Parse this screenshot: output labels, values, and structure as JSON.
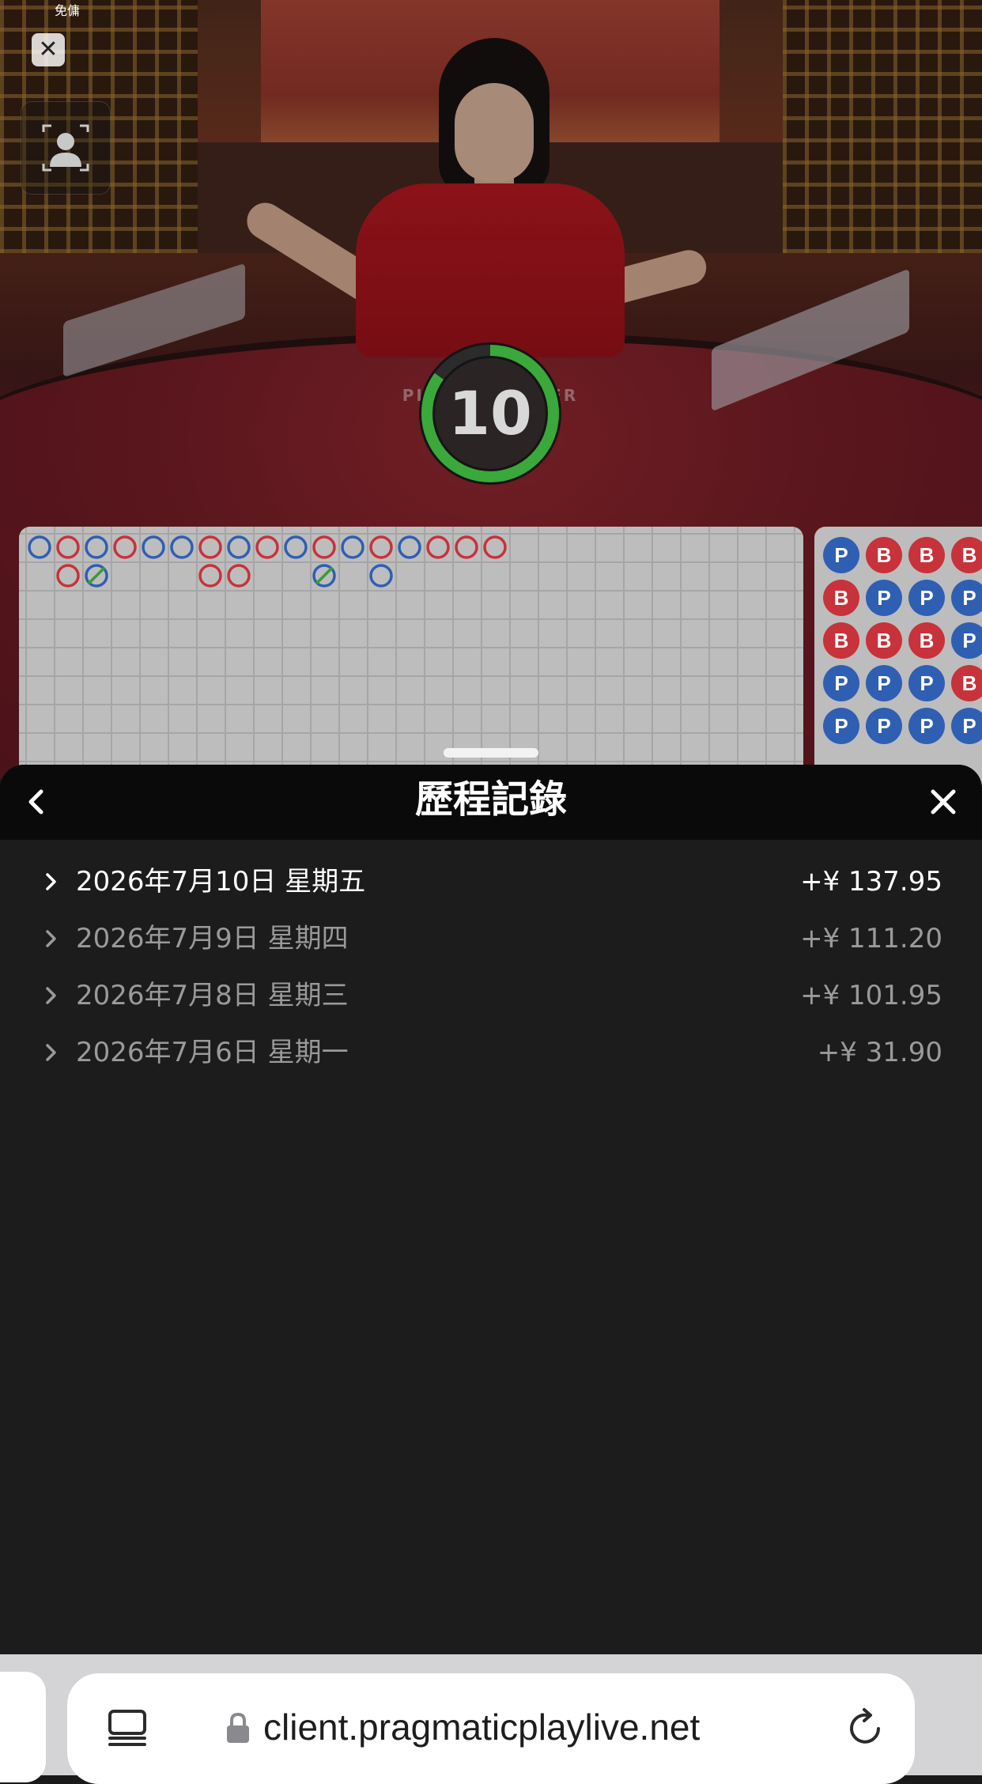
{
  "stream": {
    "mini_label": "免傭",
    "close_icon": "close-icon",
    "camera_icon": "camera-person-icon",
    "table_text": "PLAYER  BANKER",
    "timer": {
      "value": "10",
      "progress": 0.85,
      "ring_color": "#3aa83a"
    }
  },
  "roadmap": {
    "big_road_top": [
      "blue",
      "red",
      "blue",
      "red",
      "blue",
      "blue",
      "red",
      "blue",
      "red",
      "blue",
      "red",
      "blue",
      "red",
      "blue",
      "red",
      "red",
      "red"
    ],
    "big_road_second": [
      null,
      "red",
      "green-slash",
      null,
      null,
      null,
      "red-dot",
      "red",
      null,
      null,
      "green-slash",
      null,
      "blue",
      null,
      null,
      null,
      null
    ],
    "bead_plate": [
      [
        "P",
        "B",
        "B",
        "B"
      ],
      [
        "B",
        "P",
        "P",
        "P"
      ],
      [
        "B",
        "B",
        "B",
        "P"
      ],
      [
        "P",
        "P",
        "P",
        "B"
      ],
      [
        "P",
        "P",
        "P",
        "P"
      ]
    ],
    "colors": {
      "player": "#2f5fb3",
      "banker": "#c8323a",
      "tie": "#3a9a3a"
    }
  },
  "history": {
    "title": "歷程記錄",
    "back_icon": "chevron-left-icon",
    "close_icon": "close-icon",
    "rows": [
      {
        "date": "2026年7月10日 星期五",
        "amount": "+¥ 137.95"
      },
      {
        "date": "2026年7月9日 星期四",
        "amount": "+¥ 111.20"
      },
      {
        "date": "2026年7月8日 星期三",
        "amount": "+¥ 101.95"
      },
      {
        "date": "2026年7月6日 星期一",
        "amount": "+¥ 31.90"
      }
    ]
  },
  "browser": {
    "url": "client.pragmaticplaylive.net",
    "tabs_icon": "tabs-icon",
    "lock_icon": "lock-icon",
    "reload_icon": "reload-icon"
  }
}
